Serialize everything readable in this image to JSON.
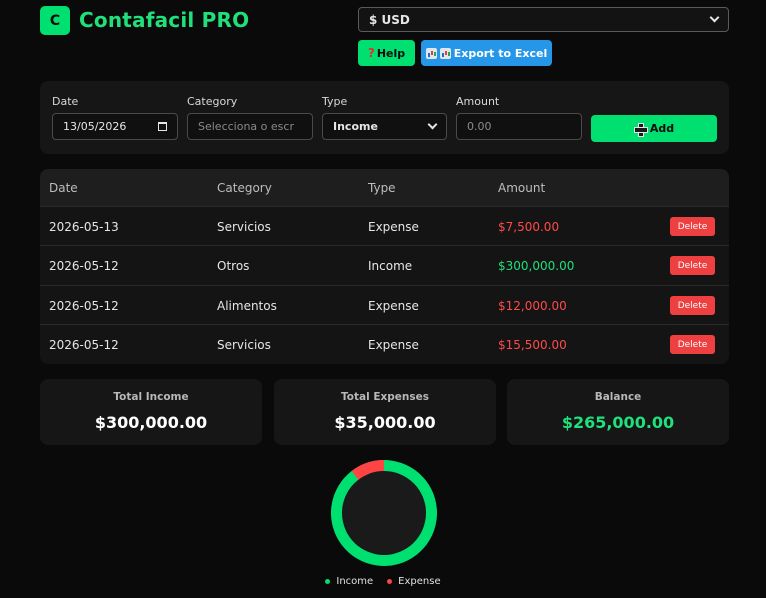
{
  "header": {
    "logo_letter": "C",
    "title": "Contafacil PRO",
    "currency": "$ USD",
    "help_label": "Help",
    "export_label": "Export to Excel"
  },
  "form": {
    "date_label": "Date",
    "date_value": "13/05/2026",
    "category_label": "Category",
    "category_placeholder": "Selecciona o escr",
    "type_label": "Type",
    "type_value": "Income",
    "amount_label": "Amount",
    "amount_placeholder": "0.00",
    "add_label": "Add"
  },
  "table": {
    "headers": [
      "Date",
      "Category",
      "Type",
      "Amount"
    ],
    "delete_label": "Delete",
    "rows": [
      {
        "date": "2026-05-13",
        "category": "Servicios",
        "type": "Expense",
        "amount": "$7,500.00",
        "kind": "expense"
      },
      {
        "date": "2026-05-12",
        "category": "Otros",
        "type": "Income",
        "amount": "$300,000.00",
        "kind": "income"
      },
      {
        "date": "2026-05-12",
        "category": "Alimentos",
        "type": "Expense",
        "amount": "$12,000.00",
        "kind": "expense"
      },
      {
        "date": "2026-05-12",
        "category": "Servicios",
        "type": "Expense",
        "amount": "$15,500.00",
        "kind": "expense"
      }
    ]
  },
  "summary": {
    "income_label": "Total Income",
    "income_value": "$300,000.00",
    "expenses_label": "Total Expenses",
    "expenses_value": "$35,000.00",
    "balance_label": "Balance",
    "balance_value": "$265,000.00"
  },
  "chart": {
    "income_value": 300000,
    "expense_value": 35000,
    "legend_income": "Income",
    "legend_expense": "Expense"
  },
  "colors": {
    "accent": "#00e071",
    "income": "#00e071",
    "expense": "#ff4444",
    "export": "#2596e8",
    "delete": "#ee4040"
  },
  "icons": {
    "help": "question-mark-icon",
    "export": "bar-chart-icon",
    "add": "plus-icon",
    "calendar": "calendar-icon",
    "select": "chevron-down-icon"
  }
}
